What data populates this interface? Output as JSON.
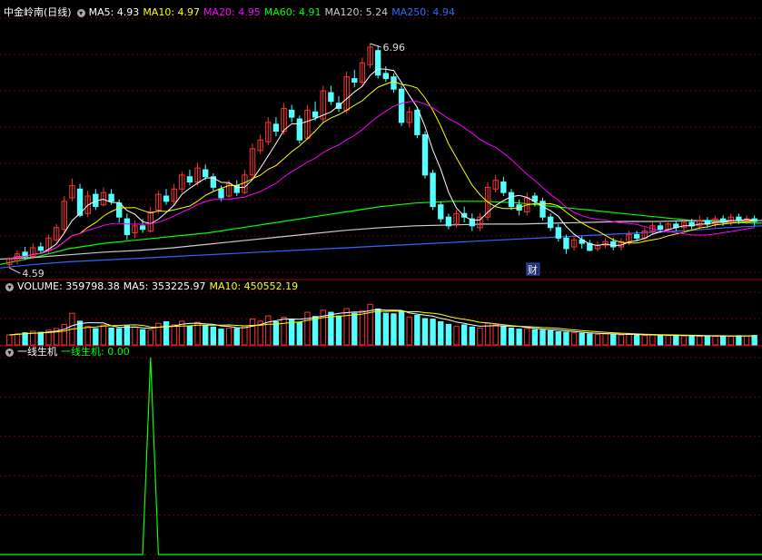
{
  "header_main": {
    "title": "中金岭南(日线)",
    "items": [
      {
        "label": "MA5: 4.93",
        "color": "#ffffff"
      },
      {
        "label": "MA10: 4.97",
        "color": "#ffff00"
      },
      {
        "label": "MA20: 4.95",
        "color": "#ff00ff"
      },
      {
        "label": "MA60: 4.91",
        "color": "#00ff00"
      },
      {
        "label": "MA120: 5.24",
        "color": "#cccccc"
      },
      {
        "label": "MA250: 4.94",
        "color": "#3366ff"
      }
    ]
  },
  "header_volume": {
    "title": "VOLUME: 359798.38",
    "items": [
      {
        "label": "MA5: 353225.97",
        "color": "#ffffff"
      },
      {
        "label": "MA10: 450552.19",
        "color": "#ffff00"
      }
    ]
  },
  "header_indicator": {
    "title": "一线生机",
    "items": [
      {
        "label": "一线生机: 0.00",
        "color": "#00ff00"
      }
    ]
  },
  "colors": {
    "up": "#ff3333",
    "down": "#54ffff",
    "grid": "#7a0000",
    "ma5": "#ffffff",
    "ma10": "#ffff00",
    "ma20": "#ff00ff",
    "ma60": "#00ff00",
    "ma120": "#cccccc",
    "ma250": "#3366ff",
    "indicator": "#00ff00"
  },
  "chart_data": {
    "type": "candlestick",
    "title": "中金岭南(日线)",
    "price_range": [
      4.35,
      7.25
    ],
    "high_label": "6.96",
    "low_label": "4.59",
    "event_marker": "财",
    "candles": [
      [
        4.44,
        4.5,
        4.4,
        4.52
      ],
      [
        4.48,
        4.56,
        4.44,
        4.6
      ],
      [
        4.58,
        4.53,
        4.49,
        4.64
      ],
      [
        4.53,
        4.63,
        4.5,
        4.68
      ],
      [
        4.64,
        4.6,
        4.56,
        4.69
      ],
      [
        4.6,
        4.74,
        4.56,
        4.78
      ],
      [
        4.72,
        4.86,
        4.68,
        4.9
      ],
      [
        4.84,
        5.16,
        4.8,
        5.22
      ],
      [
        5.2,
        5.34,
        5.16,
        5.42
      ],
      [
        5.3,
        5.0,
        4.98,
        5.36
      ],
      [
        5.02,
        5.22,
        4.98,
        5.28
      ],
      [
        5.24,
        5.1,
        5.06,
        5.3
      ],
      [
        5.12,
        5.26,
        5.1,
        5.32
      ],
      [
        5.24,
        5.16,
        5.12,
        5.3
      ],
      [
        5.14,
        4.98,
        4.92,
        5.18
      ],
      [
        4.96,
        4.78,
        4.72,
        5.02
      ],
      [
        4.8,
        4.88,
        4.74,
        4.94
      ],
      [
        4.88,
        4.84,
        4.8,
        4.96
      ],
      [
        4.82,
        5.04,
        4.8,
        5.1
      ],
      [
        5.06,
        5.24,
        5.02,
        5.28
      ],
      [
        5.22,
        5.16,
        5.12,
        5.3
      ],
      [
        5.16,
        5.3,
        5.12,
        5.36
      ],
      [
        5.3,
        5.46,
        5.26,
        5.5
      ],
      [
        5.44,
        5.38,
        5.34,
        5.52
      ],
      [
        5.38,
        5.54,
        5.34,
        5.6
      ],
      [
        5.52,
        5.44,
        5.4,
        5.58
      ],
      [
        5.44,
        5.32,
        5.28,
        5.48
      ],
      [
        5.3,
        5.2,
        5.16,
        5.34
      ],
      [
        5.22,
        5.36,
        5.2,
        5.4
      ],
      [
        5.34,
        5.26,
        5.22,
        5.4
      ],
      [
        5.26,
        5.46,
        5.24,
        5.52
      ],
      [
        5.46,
        5.76,
        5.42,
        5.82
      ],
      [
        5.74,
        5.86,
        5.7,
        5.92
      ],
      [
        5.84,
        6.06,
        5.8,
        6.12
      ],
      [
        6.04,
        5.96,
        5.9,
        6.12
      ],
      [
        5.96,
        6.22,
        5.92,
        6.28
      ],
      [
        6.2,
        6.12,
        6.06,
        6.26
      ],
      [
        6.1,
        5.86,
        5.82,
        6.14
      ],
      [
        5.88,
        6.2,
        5.86,
        6.26
      ],
      [
        6.18,
        6.12,
        6.08,
        6.3
      ],
      [
        6.1,
        6.42,
        6.06,
        6.48
      ],
      [
        6.4,
        6.3,
        6.26,
        6.48
      ],
      [
        6.28,
        6.22,
        6.18,
        6.36
      ],
      [
        6.2,
        6.58,
        6.16,
        6.64
      ],
      [
        6.56,
        6.52,
        6.46,
        6.66
      ],
      [
        6.52,
        6.74,
        6.48,
        6.8
      ],
      [
        6.72,
        6.92,
        6.68,
        6.96
      ],
      [
        6.88,
        6.6,
        6.56,
        6.94
      ],
      [
        6.62,
        6.56,
        6.52,
        6.7
      ],
      [
        6.58,
        6.44,
        6.4,
        6.62
      ],
      [
        6.44,
        6.06,
        6.02,
        6.48
      ],
      [
        6.06,
        6.18,
        6.0,
        6.24
      ],
      [
        6.2,
        5.92,
        5.88,
        6.24
      ],
      [
        5.92,
        5.46,
        5.42,
        5.96
      ],
      [
        5.48,
        5.1,
        5.06,
        5.52
      ],
      [
        5.12,
        4.96,
        4.92,
        5.16
      ],
      [
        4.98,
        4.88,
        4.84,
        5.02
      ],
      [
        4.9,
        5.02,
        4.86,
        5.06
      ],
      [
        5.02,
        4.98,
        4.92,
        5.1
      ],
      [
        4.96,
        4.88,
        4.82,
        5.02
      ],
      [
        4.86,
        4.98,
        4.82,
        5.02
      ],
      [
        4.98,
        5.32,
        4.94,
        5.38
      ],
      [
        5.3,
        5.4,
        5.26,
        5.46
      ],
      [
        5.38,
        5.26,
        5.22,
        5.44
      ],
      [
        5.26,
        5.1,
        5.06,
        5.3
      ],
      [
        5.12,
        5.06,
        5.0,
        5.18
      ],
      [
        5.04,
        5.2,
        5.0,
        5.26
      ],
      [
        5.22,
        5.16,
        5.1,
        5.26
      ],
      [
        5.16,
        4.98,
        4.94,
        5.2
      ],
      [
        4.98,
        4.86,
        4.82,
        5.02
      ],
      [
        4.86,
        4.74,
        4.7,
        4.9
      ],
      [
        4.74,
        4.62,
        4.56,
        4.78
      ],
      [
        4.64,
        4.72,
        4.6,
        4.76
      ],
      [
        4.72,
        4.68,
        4.62,
        4.76
      ],
      [
        4.68,
        4.6,
        4.59,
        4.72
      ],
      [
        4.62,
        4.66,
        4.59,
        4.7
      ],
      [
        4.66,
        4.7,
        4.62,
        4.74
      ],
      [
        4.7,
        4.64,
        4.6,
        4.74
      ],
      [
        4.64,
        4.7,
        4.6,
        4.74
      ],
      [
        4.7,
        4.78,
        4.66,
        4.82
      ],
      [
        4.78,
        4.74,
        4.7,
        4.82
      ],
      [
        4.74,
        4.82,
        4.72,
        4.86
      ],
      [
        4.82,
        4.88,
        4.78,
        4.92
      ],
      [
        4.88,
        4.84,
        4.8,
        4.92
      ],
      [
        4.84,
        4.9,
        4.8,
        4.94
      ],
      [
        4.9,
        4.86,
        4.82,
        4.94
      ],
      [
        4.86,
        4.92,
        4.82,
        4.96
      ],
      [
        4.92,
        4.88,
        4.84,
        4.96
      ],
      [
        4.88,
        4.94,
        4.84,
        5.0
      ],
      [
        4.94,
        4.9,
        4.86,
        4.98
      ],
      [
        4.9,
        4.96,
        4.86,
        5.0
      ],
      [
        4.96,
        4.92,
        4.88,
        5.0
      ],
      [
        4.92,
        4.98,
        4.88,
        5.02
      ],
      [
        4.98,
        4.94,
        4.9,
        5.02
      ],
      [
        4.94,
        4.96,
        4.9,
        5.0
      ],
      [
        4.96,
        4.93,
        4.88,
        5.0
      ]
    ],
    "ma_long": {
      "ma60": [
        4.44,
        4.52,
        4.62,
        4.68,
        4.72,
        4.76,
        4.8,
        4.86,
        4.92,
        4.98,
        5.04,
        5.1,
        5.14,
        5.16,
        5.16,
        5.14,
        5.1,
        5.06,
        5.02,
        4.98,
        4.94,
        4.92,
        4.91
      ],
      "ma120": [
        4.5,
        4.52,
        4.55,
        4.58,
        4.6,
        4.63,
        4.67,
        4.71,
        4.75,
        4.79,
        4.83,
        4.86,
        4.88,
        4.89,
        4.9,
        4.9,
        4.91,
        4.92,
        4.93,
        4.93,
        4.94,
        4.94,
        4.94
      ],
      "ma250": [
        4.4,
        4.44,
        4.47,
        4.49,
        4.51,
        4.53,
        4.55,
        4.57,
        4.59,
        4.61,
        4.63,
        4.65,
        4.67,
        4.69,
        4.71,
        4.73,
        4.75,
        4.77,
        4.79,
        4.81,
        4.83,
        4.86,
        4.88
      ]
    },
    "volume": {
      "max": 2000000,
      "values": [
        380000,
        420000,
        460000,
        520000,
        480000,
        560000,
        620000,
        780000,
        1200000,
        900000,
        700000,
        620000,
        760000,
        640000,
        620000,
        720000,
        680000,
        580000,
        560000,
        820000,
        880000,
        760000,
        900000,
        720000,
        860000,
        740000,
        680000,
        600000,
        640000,
        620000,
        720000,
        980000,
        900000,
        1100000,
        880000,
        1050000,
        980000,
        860000,
        1240000,
        1080000,
        1320000,
        1240000,
        1100000,
        1380000,
        1200000,
        1300000,
        1540000,
        1360000,
        1200000,
        1180000,
        1280000,
        1060000,
        1120000,
        1000000,
        980000,
        880000,
        780000,
        700000,
        760000,
        680000,
        640000,
        820000,
        760000,
        700000,
        640000,
        600000,
        620000,
        580000,
        560000,
        540000,
        500000,
        480000,
        460000,
        440000,
        420000,
        400000,
        420000,
        400000,
        380000,
        400000,
        380000,
        360000,
        380000,
        360000,
        350000,
        360000,
        340000,
        350000,
        330000,
        340000,
        330000,
        340000,
        330000,
        350000,
        340000,
        360000
      ]
    },
    "indicator": {
      "values": [
        0,
        0,
        0,
        0,
        0,
        0,
        0,
        0,
        0,
        0,
        0,
        0,
        0,
        0,
        0,
        0,
        0,
        0,
        1,
        0,
        0,
        0,
        0,
        0,
        0,
        0,
        0,
        0,
        0,
        0,
        0,
        0,
        0,
        0,
        0,
        0,
        0,
        0,
        0,
        0,
        0,
        0,
        0,
        0,
        0,
        0,
        0,
        0,
        0,
        0,
        0,
        0,
        0,
        0,
        0,
        0,
        0,
        0,
        0,
        0,
        0,
        0,
        0,
        0,
        0,
        0,
        0,
        0,
        0,
        0,
        0,
        0,
        0,
        0,
        0,
        0,
        0,
        0,
        0,
        0,
        0,
        0,
        0,
        0,
        0,
        0,
        0,
        0,
        0,
        0,
        0,
        0,
        0,
        0,
        0,
        0
      ]
    }
  }
}
